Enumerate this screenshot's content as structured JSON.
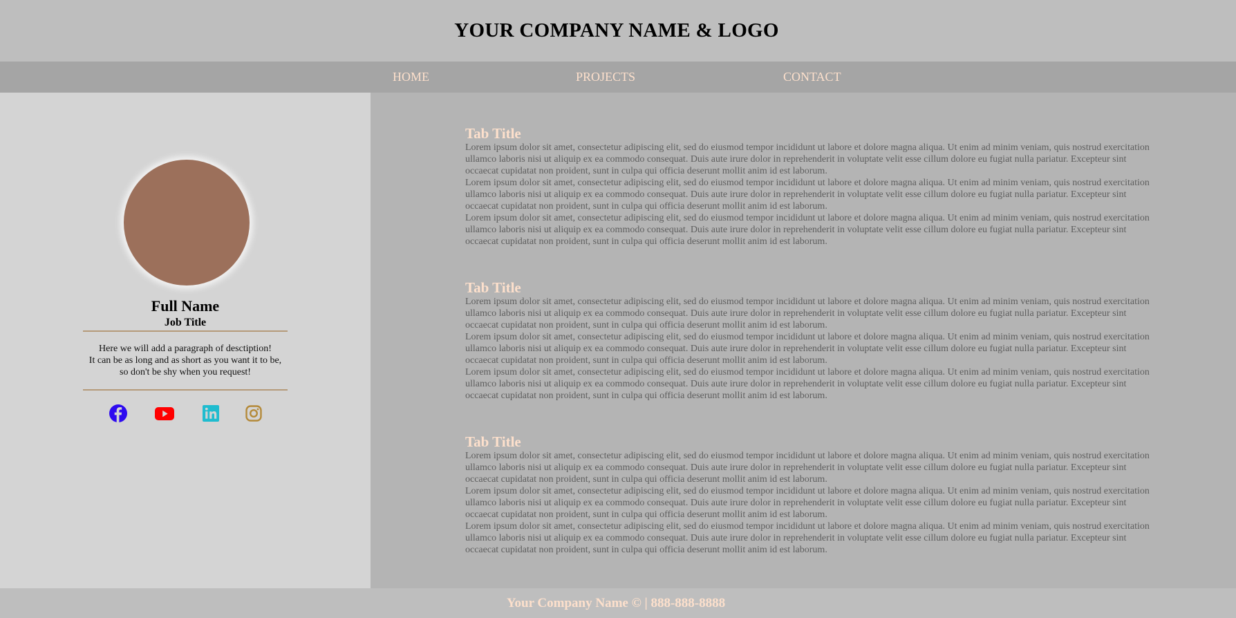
{
  "header": {
    "title": "YOUR COMPANY NAME & LOGO"
  },
  "nav": {
    "items": [
      "HOME",
      "PROJECTS",
      "CONTACT"
    ]
  },
  "profile": {
    "full_name": "Full Name",
    "job_title": "Job Title",
    "description": [
      "Here we will add a paragraph of desctiption!",
      "It can be as long and as short as you want it to be,",
      "so don't be shy when you request!"
    ],
    "socials": [
      "facebook-icon",
      "youtube-icon",
      "linkedin-icon",
      "instagram-icon"
    ]
  },
  "sections": [
    {
      "title": "Tab Title",
      "paragraphs": [
        "Lorem ipsum dolor sit amet, consectetur adipiscing elit, sed do eiusmod tempor incididunt ut labore et dolore magna aliqua. Ut enim ad minim veniam, quis nostrud exercitation ullamco laboris nisi ut aliquip ex ea commodo consequat. Duis aute irure dolor in reprehenderit in voluptate velit esse cillum dolore eu fugiat nulla pariatur. Excepteur sint occaecat cupidatat non proident, sunt in culpa qui officia deserunt mollit anim id est laborum.",
        "Lorem ipsum dolor sit amet, consectetur adipiscing elit, sed do eiusmod tempor incididunt ut labore et dolore magna aliqua. Ut enim ad minim veniam, quis nostrud exercitation ullamco laboris nisi ut aliquip ex ea commodo consequat. Duis aute irure dolor in reprehenderit in voluptate velit esse cillum dolore eu fugiat nulla pariatur. Excepteur sint occaecat cupidatat non proident, sunt in culpa qui officia deserunt mollit anim id est laborum.",
        "Lorem ipsum dolor sit amet, consectetur adipiscing elit, sed do eiusmod tempor incididunt ut labore et dolore magna aliqua. Ut enim ad minim veniam, quis nostrud exercitation ullamco laboris nisi ut aliquip ex ea commodo consequat. Duis aute irure dolor in reprehenderit in voluptate velit esse cillum dolore eu fugiat nulla pariatur. Excepteur sint occaecat cupidatat non proident, sunt in culpa qui officia deserunt mollit anim id est laborum."
      ]
    },
    {
      "title": "Tab Title",
      "paragraphs": [
        "Lorem ipsum dolor sit amet, consectetur adipiscing elit, sed do eiusmod tempor incididunt ut labore et dolore magna aliqua. Ut enim ad minim veniam, quis nostrud exercitation ullamco laboris nisi ut aliquip ex ea commodo consequat. Duis aute irure dolor in reprehenderit in voluptate velit esse cillum dolore eu fugiat nulla pariatur. Excepteur sint occaecat cupidatat non proident, sunt in culpa qui officia deserunt mollit anim id est laborum.",
        "Lorem ipsum dolor sit amet, consectetur adipiscing elit, sed do eiusmod tempor incididunt ut labore et dolore magna aliqua. Ut enim ad minim veniam, quis nostrud exercitation ullamco laboris nisi ut aliquip ex ea commodo consequat. Duis aute irure dolor in reprehenderit in voluptate velit esse cillum dolore eu fugiat nulla pariatur. Excepteur sint occaecat cupidatat non proident, sunt in culpa qui officia deserunt mollit anim id est laborum.",
        "Lorem ipsum dolor sit amet, consectetur adipiscing elit, sed do eiusmod tempor incididunt ut labore et dolore magna aliqua. Ut enim ad minim veniam, quis nostrud exercitation ullamco laboris nisi ut aliquip ex ea commodo consequat. Duis aute irure dolor in reprehenderit in voluptate velit esse cillum dolore eu fugiat nulla pariatur. Excepteur sint occaecat cupidatat non proident, sunt in culpa qui officia deserunt mollit anim id est laborum."
      ]
    },
    {
      "title": "Tab Title",
      "paragraphs": [
        "Lorem ipsum dolor sit amet, consectetur adipiscing elit, sed do eiusmod tempor incididunt ut labore et dolore magna aliqua. Ut enim ad minim veniam, quis nostrud exercitation ullamco laboris nisi ut aliquip ex ea commodo consequat. Duis aute irure dolor in reprehenderit in voluptate velit esse cillum dolore eu fugiat nulla pariatur. Excepteur sint occaecat cupidatat non proident, sunt in culpa qui officia deserunt mollit anim id est laborum.",
        "Lorem ipsum dolor sit amet, consectetur adipiscing elit, sed do eiusmod tempor incididunt ut labore et dolore magna aliqua. Ut enim ad minim veniam, quis nostrud exercitation ullamco laboris nisi ut aliquip ex ea commodo consequat. Duis aute irure dolor in reprehenderit in voluptate velit esse cillum dolore eu fugiat nulla pariatur. Excepteur sint occaecat cupidatat non proident, sunt in culpa qui officia deserunt mollit anim id est laborum.",
        "Lorem ipsum dolor sit amet, consectetur adipiscing elit, sed do eiusmod tempor incididunt ut labore et dolore magna aliqua. Ut enim ad minim veniam, quis nostrud exercitation ullamco laboris nisi ut aliquip ex ea commodo consequat. Duis aute irure dolor in reprehenderit in voluptate velit esse cillum dolore eu fugiat nulla pariatur. Excepteur sint occaecat cupidatat non proident, sunt in culpa qui officia deserunt mollit anim id est laborum."
      ]
    }
  ],
  "footer": {
    "text": "Your Company Name © | 888-888-8888"
  },
  "colors": {
    "accent": "#fde0cc",
    "avatar": "#9c705b",
    "divider": "#b59a7a",
    "facebook": "#2e0bf0",
    "youtube": "#ff0000",
    "linkedin": "#1fbccf",
    "instagram": "#b48a3a"
  }
}
